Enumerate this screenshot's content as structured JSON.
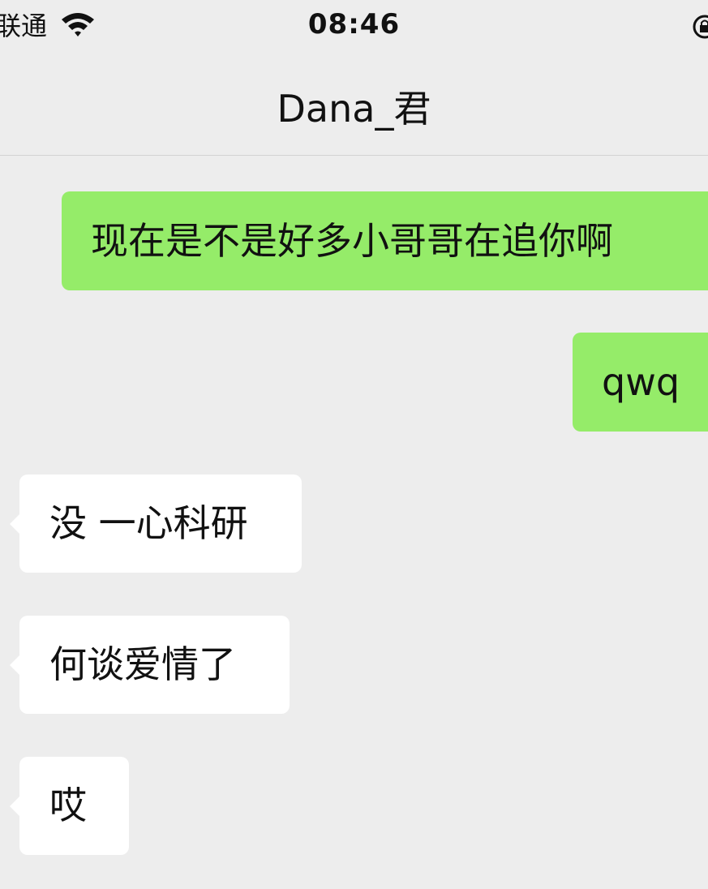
{
  "status_bar": {
    "carrier": "联通",
    "time": "08:46"
  },
  "nav": {
    "title": "Dana_君"
  },
  "messages": [
    {
      "side": "out",
      "text": "现在是不是好多小哥哥在追你啊"
    },
    {
      "side": "out",
      "text": "qwq"
    },
    {
      "side": "in",
      "text": "没 一心科研"
    },
    {
      "side": "in",
      "text": "何谈爱情了"
    },
    {
      "side": "in",
      "text": "哎"
    }
  ],
  "colors": {
    "background": "#ededed",
    "outgoing_bubble": "#95ec69",
    "incoming_bubble": "#ffffff"
  },
  "icons": [
    "wifi-icon",
    "orientation-lock-icon"
  ]
}
